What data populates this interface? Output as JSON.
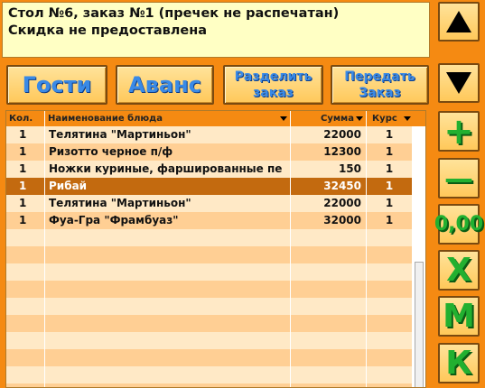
{
  "info": {
    "line1": "Стол №6, заказ №1 (пречек не распечатан)",
    "line2": "Скидка не предоставлена"
  },
  "buttons": {
    "guests": "Гости",
    "advance": "Аванс",
    "split_line1": "Разделить",
    "split_line2": "заказ",
    "transfer_line1": "Передать",
    "transfer_line2": "Заказ"
  },
  "side_buttons": {
    "up_icon": "triangle-up-icon",
    "down_icon": "triangle-down-icon",
    "plus": "+",
    "minus": "—",
    "zero": "0,00",
    "x": "X",
    "m": "M",
    "k": "К"
  },
  "table": {
    "columns": [
      "Кол.",
      "Наименование блюда",
      "Сумма",
      "Курс"
    ],
    "rows": [
      {
        "qty": "1",
        "name": "Телятина \"Мартиньон\"",
        "sum": "22000",
        "course": "1"
      },
      {
        "qty": "1",
        "name": "Ризотто черное п/ф",
        "sum": "12300",
        "course": "1"
      },
      {
        "qty": "1",
        "name": "Ножки куриные, фаршированные пе",
        "sum": "150",
        "course": "1"
      },
      {
        "qty": "1",
        "name": "Рибай",
        "sum": "32450",
        "course": "1"
      },
      {
        "qty": "1",
        "name": "Телятина \"Мартиньон\"",
        "sum": "22000",
        "course": "1"
      },
      {
        "qty": "1",
        "name": "Фуа-Гра \"Фрамбуаз\"",
        "sum": "32000",
        "course": "1"
      }
    ],
    "selected_row": 3
  },
  "colors": {
    "background": "#f58a12",
    "info_bg": "#ffffc4",
    "selected_row": "#c36a0f",
    "accent_blue": "#3a8ae6",
    "accent_green": "#22b030"
  }
}
